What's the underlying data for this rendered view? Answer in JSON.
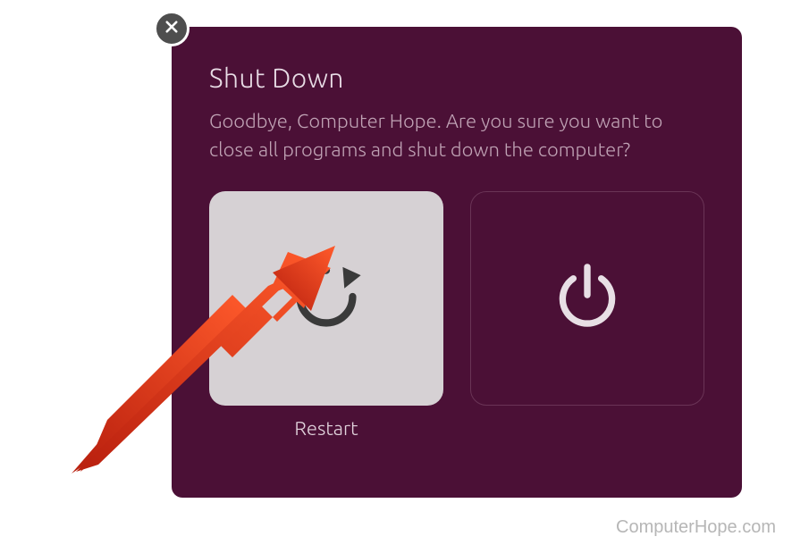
{
  "dialog": {
    "title": "Shut Down",
    "message": "Goodbye, Computer Hope. Are you sure you want to close all programs and shut down the computer?",
    "restart_label": "Restart"
  },
  "watermark": "ComputerHope.com"
}
